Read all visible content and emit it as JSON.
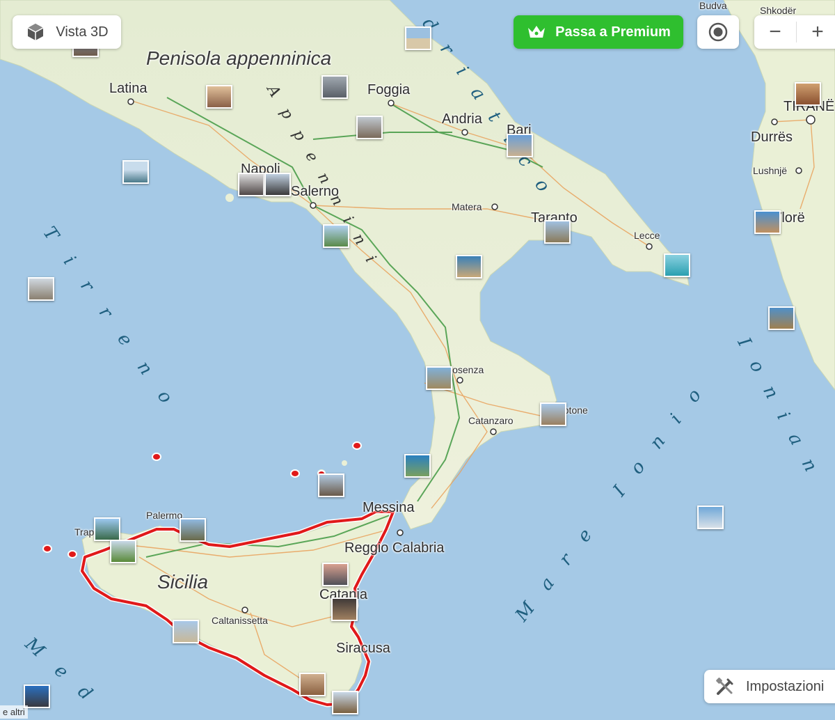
{
  "controls": {
    "view3d_label": "Vista 3D",
    "premium_label": "Passa a Premium",
    "zoom_out": "−",
    "zoom_in": "+",
    "settings_label": "Impostazioni",
    "attribution": "e altri"
  },
  "regions": {
    "peninsula": "Penisola appenninica",
    "sicily": "Sicilia"
  },
  "seas": {
    "adriatico": "driatico",
    "tirreno": "Tirreno",
    "ionio": "Mare Ionio",
    "ionian": "Ionian",
    "mediterraneo": "Med",
    "appennini": "Appennini"
  },
  "cities": {
    "latina": "Latina",
    "foggia": "Foggia",
    "andria": "Andria",
    "bari": "Bari",
    "napoli": "Napoli",
    "salerno": "Salerno",
    "matera": "Matera",
    "taranto": "Taranto",
    "lecce": "Lecce",
    "cosenza": "Cosenza",
    "crotone": "Crotone",
    "catanzaro": "Catanzaro",
    "messina": "Messina",
    "reggio": "Reggio Calabria",
    "palermo": "Palermo",
    "trapani": "Trapani",
    "catania": "Catania",
    "caltanissetta": "Caltanissetta",
    "siracusa": "Siracusa",
    "budva": "Budva",
    "shkoder": "Shkodër",
    "durres": "Durrës",
    "lushnje": "Lushnjë",
    "tirane": "TIRANË",
    "vlore": "Vlorë"
  },
  "colors": {
    "sea": "#a5c9e6",
    "land": "#eaf0d8",
    "route": "#e0191a",
    "premium": "#2fbf2f"
  }
}
